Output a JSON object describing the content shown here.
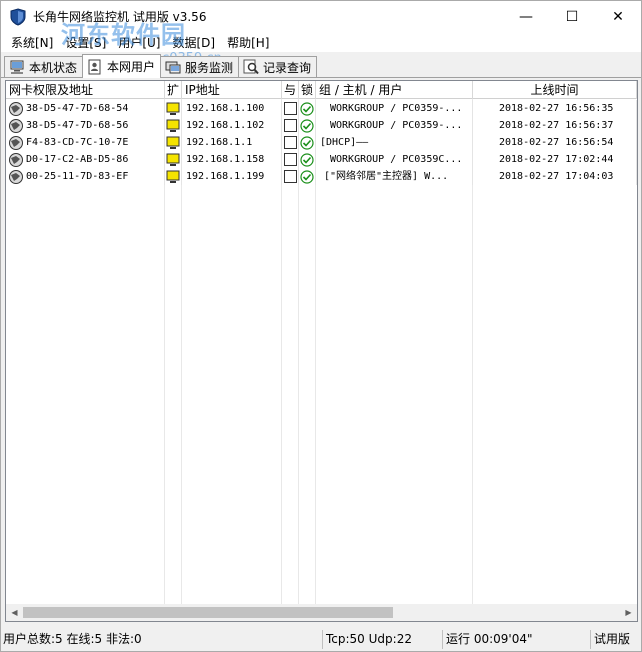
{
  "window": {
    "title": "长角牛网络监控机 试用版 v3.56",
    "controls": {
      "minimize": "—",
      "maximize": "☐",
      "close": "✕"
    }
  },
  "watermark": {
    "main": "河东软件园",
    "url": "www.pc0359.cn"
  },
  "menu": [
    "系统[N]",
    "设置[S]",
    "用户[U]",
    "数据[D]",
    "帮助[H]"
  ],
  "tabs": [
    {
      "label": "本机状态",
      "icon": "computer-icon"
    },
    {
      "label": "本网用户",
      "icon": "users-icon",
      "active": true
    },
    {
      "label": "服务监测",
      "icon": "monitor-icon"
    },
    {
      "label": "记录查询",
      "icon": "search-icon"
    }
  ],
  "table": {
    "headers": {
      "mac": "网卡权限及地址",
      "ext": "扩",
      "ip": "IP地址",
      "flag1": "与",
      "flag2": "锁",
      "group": "组 / 主机 / 用户",
      "time": "上线时间"
    },
    "rows": [
      {
        "mac": "38-D5-47-7D-68-54",
        "ip": "192.168.1.100",
        "group": "WORKGROUP / PC0359-...",
        "time": "2018-02-27 16:56:35"
      },
      {
        "mac": "38-D5-47-7D-68-56",
        "ip": "192.168.1.102",
        "group": "WORKGROUP / PC0359-...",
        "time": "2018-02-27 16:56:37"
      },
      {
        "mac": "F4-83-CD-7C-10-7E",
        "ip": "192.168.1.1",
        "group": "[DHCP]——",
        "time": "2018-02-27 16:56:54"
      },
      {
        "mac": "D0-17-C2-AB-D5-86",
        "ip": "192.168.1.158",
        "group": "WORKGROUP / PC0359C...",
        "time": "2018-02-27 17:02:44"
      },
      {
        "mac": "00-25-11-7D-83-EF",
        "ip": "192.168.1.199",
        "group": "[\"网络邻居\"主控器] W...",
        "time": "2018-02-27 17:04:03"
      }
    ]
  },
  "status": {
    "users": "用户总数:5 在线:5 非法:0",
    "traffic": "Tcp:50 Udp:22",
    "runtime": "运行 00:09'04\"",
    "edition": "试用版"
  },
  "colors": {
    "accent": "#0078d7",
    "check": "#1a8f1a"
  }
}
